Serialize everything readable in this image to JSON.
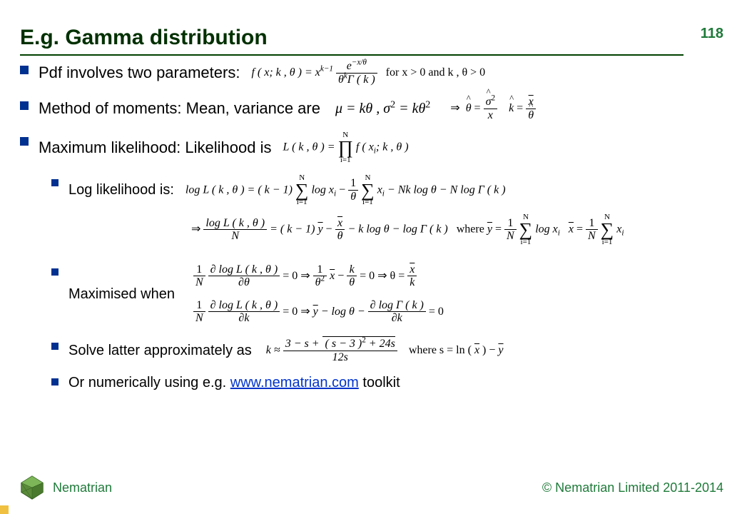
{
  "page": {
    "title": "E.g. Gamma distribution",
    "number": "118"
  },
  "bullets": {
    "b1": "Pdf involves two parameters:",
    "b2": "Method of moments: Mean, variance are",
    "b3": "Maximum likelihood: Likelihood is",
    "s1": "Log likelihood is:",
    "s2": "Maximised when",
    "s3": "Solve latter approximately as",
    "s4_pre": "Or numerically using e.g. ",
    "s4_link": "www.nematrian.com",
    "s4_post": " toolkit"
  },
  "formulas": {
    "pdf_lhs": "f ( x; k , θ ) = x",
    "pdf_exp1": "k−1",
    "pdf_frac_num_e": "e",
    "pdf_frac_num_exp": "−x/θ",
    "pdf_frac_den_1": "θ",
    "pdf_frac_den_exp": "k",
    "pdf_frac_den_2": "Γ ( k )",
    "pdf_cond": "for x > 0 and k , θ > 0",
    "mom": "μ = kθ , σ",
    "mom_sq": "2",
    "mom2": " = kθ",
    "mom2_sq": "2",
    "mom_arrow": "⇒",
    "mom_th": "θ",
    "mom_eq": " = ",
    "mom_frac_num_sig": "σ",
    "mom_frac_num_exp": "2",
    "mom_frac_den": "x",
    "mom_k": "k",
    "mom_k_eq": " = ",
    "mom_k_num": "x",
    "mom_k_den": "θ",
    "lik_lhs": "L ( k , θ ) = ",
    "lik_prod_top": "N",
    "lik_prod_op": "∏",
    "lik_prod_bot": "i=1",
    "lik_rhs": " f ( x",
    "lik_rhs_sub": "i",
    "lik_rhs2": "; k , θ )",
    "ll1_a": "log L ( k , θ ) = ( k − 1) ",
    "ll1_sum_top": "N",
    "ll1_sum_op": "∑",
    "ll1_sum_bot": "i=1",
    "ll1_b": " log x",
    "ll1_b_sub": "i",
    "ll1_c": " − ",
    "ll1_frac_num": "1",
    "ll1_frac_den": "θ",
    "ll1_d": " x",
    "ll1_d_sub": "i",
    "ll1_e": " − Nk log θ − N log Γ ( k )",
    "ll2_arrow": "⇒ ",
    "ll2_frac_num": "log L ( k , θ )",
    "ll2_frac_den": "N",
    "ll2_eq": " = ( k − 1) ",
    "ll2_y": "y",
    "ll2_mid": " − ",
    "ll2_frac2_num": "x",
    "ll2_frac2_den": "θ",
    "ll2_end": " − k log θ − log Γ ( k )",
    "ll2_where": "where ",
    "ll2_y_def_a": "y",
    "ll2_y_def_eq": " = ",
    "ll2_y_def_frac_num": "1",
    "ll2_y_def_frac_den": "N",
    "ll2_y_def_b": " log x",
    "ll2_y_def_b_sub": "i",
    "ll2_x_def_a": "x",
    "ll2_x_def_frac_num": "1",
    "ll2_x_def_frac_den": "N",
    "ll2_x_def_b": " x",
    "ll2_x_def_b_sub": "i",
    "max1_a_num": "1",
    "max1_a_den": "N",
    "max1_b_num": "∂ log L ( k , θ )",
    "max1_b_den": "∂θ",
    "max1_c": " = 0   ⇒   ",
    "max1_d_num": "1",
    "max1_d_den_a": "θ",
    "max1_d_den_exp": "2",
    "max1_e": "x",
    "max1_f": " − ",
    "max1_g_num": "k",
    "max1_g_den": "θ",
    "max1_h": " = 0   ⇒   θ = ",
    "max1_i_num": "x",
    "max1_i_den": "k",
    "max2_a_num": "1",
    "max2_a_den": "N",
    "max2_b_num": "∂ log L ( k , θ )",
    "max2_b_den": "∂k",
    "max2_c": " = 0   ⇒   ",
    "max2_y": "y",
    "max2_d": " − log θ − ",
    "max2_e_num": "∂ log Γ ( k )",
    "max2_e_den": "∂k",
    "max2_f": " = 0",
    "approx_a": "k ≈ ",
    "approx_num_a": "3 − s + ",
    "approx_num_sqrt_inner": "( s − 3 )",
    "approx_num_sqrt_exp": "2",
    "approx_num_sqrt_end": " + 24s",
    "approx_den": "12s",
    "approx_where": "where   s = ln ( ",
    "approx_x": "x",
    "approx_where_end": " ) − ",
    "approx_y": "y"
  },
  "footer": {
    "brand": "Nematrian",
    "copyright": "© Nematrian Limited 2011-2014"
  }
}
